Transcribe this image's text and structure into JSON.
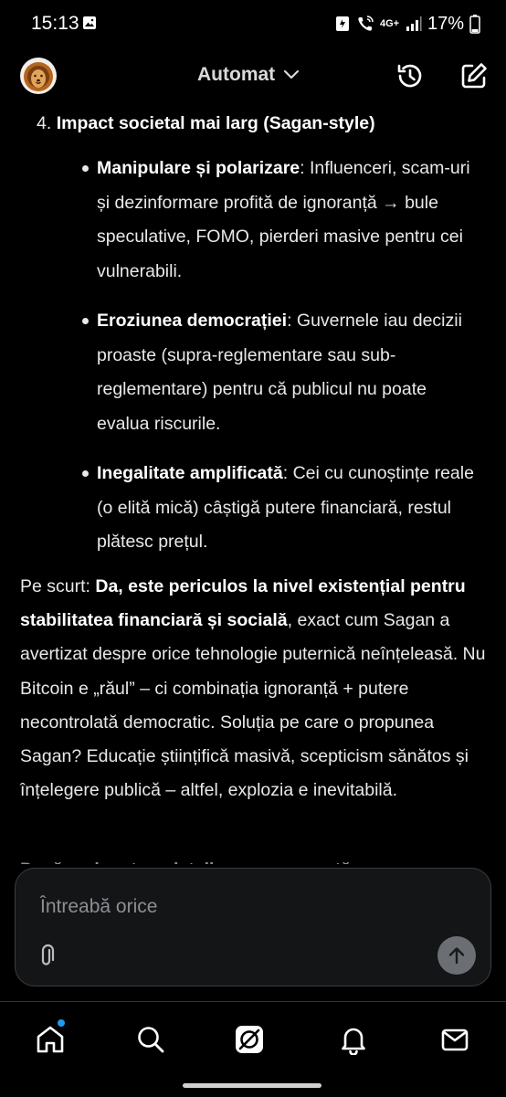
{
  "status": {
    "time": "15:13",
    "network": "4G+",
    "battery": "17%"
  },
  "header": {
    "model_label": "Automat",
    "icons": [
      "lion-avatar",
      "history-icon",
      "compose-icon",
      "chevron-down-icon"
    ]
  },
  "message": {
    "item4_number": "4.",
    "item4_title": "Impact societal mai larg (Sagan-style)",
    "bullets": [
      {
        "bold": "Manipulare și polarizare",
        "text": ": Influenceri, scam-uri și dezinformare profită de ignoranță → bule speculative, FOMO, pierderi masive pentru cei vulnerabili."
      },
      {
        "bold": "Eroziunea democrației",
        "text": ": Guvernele iau decizii proaste (supra-reglementare sau sub-reglementare) pentru că publicul nu poate evalua riscurile."
      },
      {
        "bold": "Inegalitate amplificată",
        "text": ": Cei cu cunoștințe reale (o elită mică) câștigă putere financiară, restul plătesc prețul."
      }
    ],
    "summary_prefix": "Pe scurt: ",
    "summary_bold": "Da, este periculos la nivel existențial pentru stabilitatea financiară și socială",
    "summary_rest": ", exact cum Sagan a avertizat despre orice tehnologie puternică neînțeleasă. Nu Bitcoin e „răul” – ci combinația ignoranță + putere necontrolată democratic. Soluția pe care o propunea Sagan? Educație științifică masivă, scepticism sănătos și înțelegere publică – altfel, explozia e inevitabilă.",
    "cutoff_line": "Dacă vrei, putem detalia o componentă anume"
  },
  "composer": {
    "placeholder": "Întreabă orice"
  },
  "nav": {
    "icons": [
      "home-icon",
      "search-icon",
      "grok-icon",
      "notifications-icon",
      "messages-icon"
    ]
  },
  "colors": {
    "background": "#000000",
    "text": "#e7e9ea",
    "accent_dot": "#1d9bf0",
    "send_button": "#6b6f73"
  }
}
